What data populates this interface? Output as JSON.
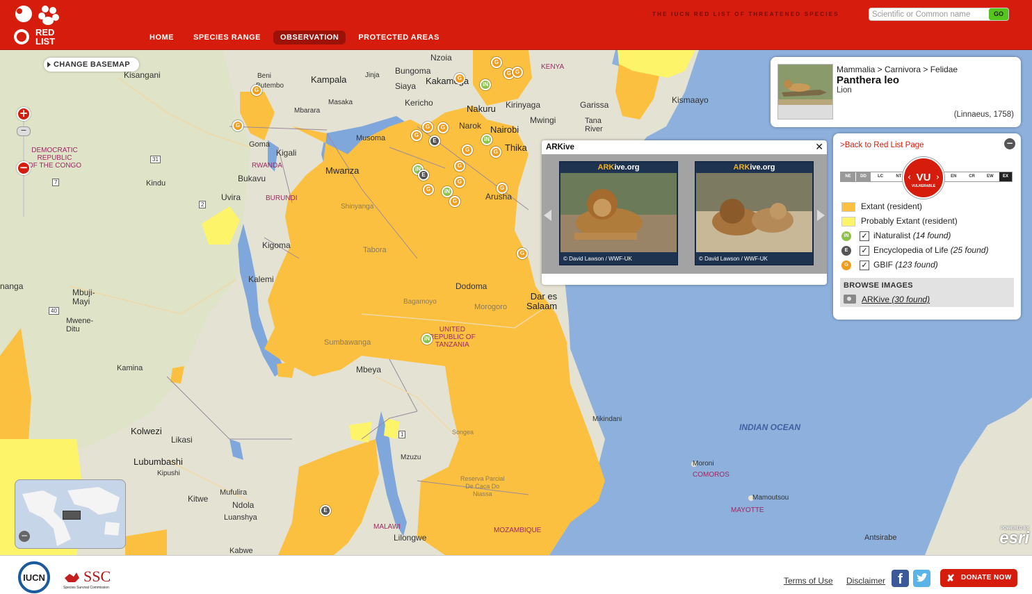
{
  "header": {
    "tagline": "THE IUCN RED LIST OF THREATENED SPECIES",
    "logo_text": "RED LIST",
    "search_placeholder": "Scientific or Common name",
    "go_label": "GO",
    "nav": [
      "HOME",
      "SPECIES RANGE",
      "OBSERVATION",
      "PROTECTED AREAS"
    ],
    "active_nav": "OBSERVATION",
    "brand_color": "#d61c0c"
  },
  "map": {
    "change_basemap": "CHANGE BASEMAP",
    "zoom_in": "+",
    "zoom_out": "−",
    "slider_label": "−",
    "overview_close": "−",
    "labels": {
      "kisangani": "Kisangani",
      "beni": "Beni",
      "butembo": "Butembo",
      "kampala": "Kampala",
      "jinja": "Jinja",
      "bungoma": "Bungoma",
      "nzoia": "Nzoia",
      "kakamega": "Kakamega",
      "siaya": "Siaya",
      "kericho": "Kericho",
      "nakuru": "Nakuru",
      "kirinyaga": "Kirinyaga",
      "garissa": "Garissa",
      "kismaayo": "Kismaayo",
      "masaka": "Masaka",
      "mbarara": "Mbarara",
      "narok": "Narok",
      "nairobi": "Nairobi",
      "mwingi": "Mwingi",
      "tana_river": "Tana\nRiver",
      "thika": "Thika",
      "goma": "Goma",
      "kigali": "Kigali",
      "musoma": "Musoma",
      "mwanza": "Mwanza",
      "arusha": "Arusha",
      "bukavu": "Bukavu",
      "uvira": "Uvira",
      "kindu": "Kindu",
      "shinyanga": "Shinyanga",
      "tabora": "Tabora",
      "kigoma": "Kigoma",
      "kalemi": "Kalemi",
      "dodoma": "Dodoma",
      "dar_es_salaam": "Dar es\nSalaam",
      "mbuji_mayi": "Mbuji-\nMayi",
      "mwene_ditu": "Mwene-\nDitu",
      "sumbawanga": "Sumbawanga",
      "morogoro": "Morogoro",
      "bagamoyo": "Bagamoyo",
      "kamina": "Kamina",
      "mbeya": "Mbeya",
      "kolwezi": "Kolwezi",
      "likasi": "Likasi",
      "lubumbashi": "Lubumbashi",
      "kipushi": "Kipushi",
      "mzuzu": "Mzuzu",
      "mikindani": "Mikindani",
      "kitwe": "Kitwe",
      "mufulira": "Mufulira",
      "ndola": "Ndola",
      "luanshya": "Luanshya",
      "lilongwe": "Lilongwe",
      "kabwe": "Kabwe",
      "moroni": "Moroni",
      "mamoutsou": "Mamoutsou",
      "antsirabe": "Antsirabe",
      "nanga": "nanga",
      "reserva": "Reserva Parcial\nDe Caca Do\nNiassa",
      "songea": "Songea",
      "indian_ocean": "INDIAN OCEAN",
      "kenya": "KENYA",
      "drc": "DEMOCRATIC\nREPUBLIC\nOF THE CONGO",
      "rwanda": "RWANDA",
      "burundi": "BURUNDI",
      "tanzania": "UNITED\nREPUBLIC OF\nTANZANIA",
      "malawi": "MALAWI",
      "mozambique": "MOZAMBIQUE",
      "comoros": "COMOROS",
      "mayotte": "MAYOTTE",
      "road_31": "31",
      "road_7": "7",
      "road_2": "2",
      "road_40": "40",
      "road_1": "1"
    },
    "markers": {
      "gbif": "G",
      "inat": "iN",
      "eol": "E"
    },
    "esri_powered": "POWERED BY",
    "esri_name": "esri"
  },
  "species": {
    "taxonomy": "Mammalia > Carnivora > Felidae",
    "scientific_name": "Panthera leo",
    "common_name": "Lion",
    "authority": "(Linnaeus, 1758)"
  },
  "panel": {
    "back_link": ">Back to Red List Page",
    "status_scale": [
      "NE",
      "DD",
      "LC",
      "NT",
      "VU",
      "EN",
      "CR",
      "EW",
      "EX"
    ],
    "status_code": "VU",
    "status_label": "VULNERABLE",
    "legend": [
      {
        "label": "Extant (resident)",
        "color": "#fbc040"
      },
      {
        "label": "Probably Extant (resident)",
        "color": "#fdf46a"
      }
    ],
    "sources": [
      {
        "name": "iNaturalist",
        "count": "(14 found)",
        "checked": true,
        "color": "#8bc34a"
      },
      {
        "name": "Encyclopedia of Life",
        "count": "(25 found)",
        "checked": true,
        "color": "#555555"
      },
      {
        "name": "GBIF",
        "count": "(123 found)",
        "checked": true,
        "color": "#f39c1a"
      }
    ],
    "browse_title": "BROWSE IMAGES",
    "arkive_name": "ARKive",
    "arkive_count": "(30 found)"
  },
  "arkive_popup": {
    "title": "ARKive",
    "close": "✕",
    "brand_prefix": "ARK",
    "brand_suffix": "ive.org",
    "photos": [
      {
        "credit": "© David Lawson / WWF-UK"
      },
      {
        "credit": "© David Lawson / WWF-UK"
      }
    ]
  },
  "footer": {
    "iucn": "IUCN",
    "ssc": "SSC",
    "ssc_sub": "Species Survival Commission",
    "terms": "Terms of Use",
    "disclaimer": "Disclaimer",
    "facebook": "f",
    "donate": "DONATE NOW"
  }
}
